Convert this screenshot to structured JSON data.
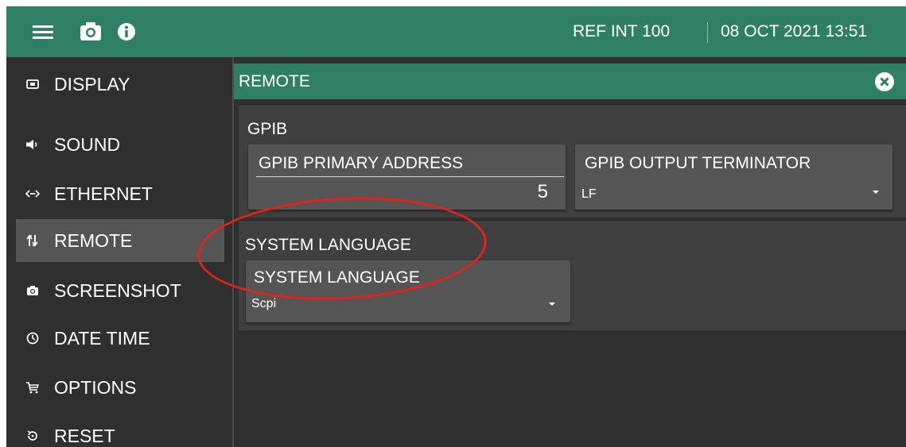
{
  "topbar": {
    "icons": [
      "menu-icon",
      "camera-icon",
      "info-icon"
    ],
    "reference": "REF INT 100",
    "datetime": "08 OCT 2021 13:51"
  },
  "sidebar": {
    "items": [
      {
        "label": "DISPLAY",
        "icon": "display-icon"
      },
      {
        "label": "SOUND",
        "icon": "speaker-icon"
      },
      {
        "label": "ETHERNET",
        "icon": "ethernet-icon"
      },
      {
        "label": "REMOTE",
        "icon": "remote-icon",
        "active": true
      },
      {
        "label": "SCREENSHOT",
        "icon": "camera-icon"
      },
      {
        "label": "DATE TIME",
        "icon": "clock-icon"
      },
      {
        "label": "OPTIONS",
        "icon": "cart-icon"
      },
      {
        "label": "RESET",
        "icon": "reset-icon"
      }
    ]
  },
  "panel": {
    "title": "REMOTE",
    "close_icon": "close-circle-icon"
  },
  "gpib": {
    "title": "GPIB",
    "primary_address": {
      "label": "GPIB PRIMARY ADDRESS",
      "value": "5"
    },
    "output_terminator": {
      "label": "GPIB OUTPUT TERMINATOR",
      "value": "LF"
    }
  },
  "system_language": {
    "title": "SYSTEM LANGUAGE",
    "field": {
      "label": "SYSTEM LANGUAGE",
      "value": "Scpi"
    }
  },
  "colors": {
    "accent": "#2e7f63",
    "background": "#303030",
    "active_item": "#555555",
    "annotation": "#e2231a"
  }
}
